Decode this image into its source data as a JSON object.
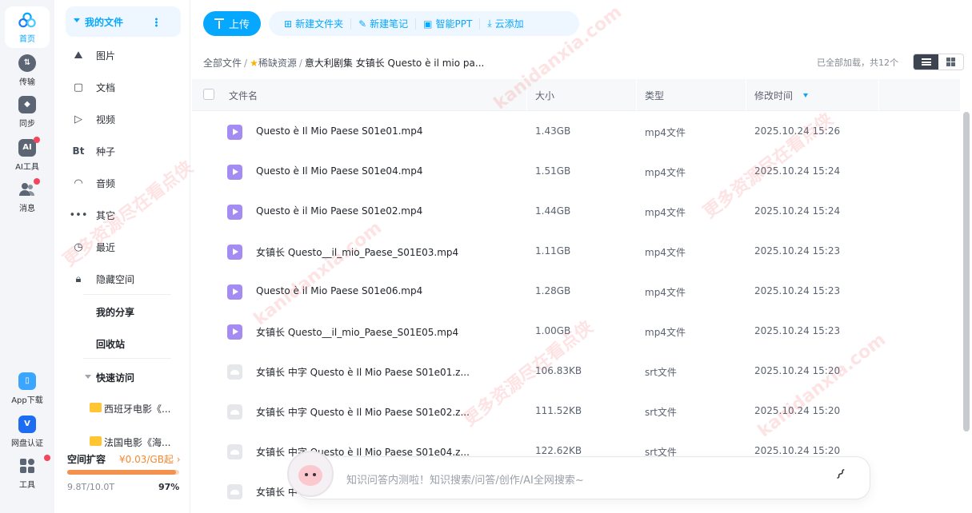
{
  "rail": {
    "home": "首页",
    "transfer": "传输",
    "sync": "同步",
    "ai_tools": "AI工具",
    "messages": "消息",
    "app_download": "App下载",
    "verify": "网盘认证",
    "tools": "工具"
  },
  "nav": {
    "my_files": "我的文件",
    "items": [
      "图片",
      "文档",
      "视频",
      "种子",
      "音频",
      "其它",
      "最近",
      "隐藏空间"
    ],
    "my_share": "我的分享",
    "recycle": "回收站",
    "quick_access": "快速访问",
    "quick_items": [
      "西班牙电影《...",
      "法国电影《海..."
    ],
    "space_label": "空间扩容",
    "space_price": "¥0.03/GB起 ›",
    "space_used": "9.8T/10.0T",
    "space_pct": "97%",
    "space_fraction": 0.97
  },
  "toolbar": {
    "upload": "上传",
    "new_folder": "新建文件夹",
    "new_note": "新建笔记",
    "smart_ppt": "智能PPT",
    "cloud_add": "云添加"
  },
  "breadcrumb": {
    "root": "全部文件",
    "level1": "稀缺资源",
    "current": "意大利剧集 女镇长 Questo è il mio pa..."
  },
  "status": {
    "loaded": "已全部加载，共12个"
  },
  "table": {
    "headers": {
      "name": "文件名",
      "size": "大小",
      "type": "类型",
      "modified": "修改时间"
    },
    "rows": [
      {
        "icon": "video",
        "name": "Questo è Il Mio Paese S01e01.mp4",
        "size": "1.43GB",
        "type": "mp4文件",
        "date": "2025.10.24 15:26"
      },
      {
        "icon": "video",
        "name": "Questo è Il Mio Paese S01e04.mp4",
        "size": "1.51GB",
        "type": "mp4文件",
        "date": "2025.10.24 15:24"
      },
      {
        "icon": "video",
        "name": "Questo è il Mio Paese S01e02.mp4",
        "size": "1.44GB",
        "type": "mp4文件",
        "date": "2025.10.24 15:24"
      },
      {
        "icon": "video",
        "name": "女镇长 Questo__il_mio_Paese_S01E03.mp4",
        "size": "1.11GB",
        "type": "mp4文件",
        "date": "2025.10.24 15:23"
      },
      {
        "icon": "video",
        "name": "Questo è il Mio Paese S01e06.mp4",
        "size": "1.28GB",
        "type": "mp4文件",
        "date": "2025.10.24 15:23"
      },
      {
        "icon": "video",
        "name": "女镇长 Questo__il_mio_Paese_S01E05.mp4",
        "size": "1.00GB",
        "type": "mp4文件",
        "date": "2025.10.24 15:23"
      },
      {
        "icon": "srt",
        "name": "女镇长 中字 Questo è Il Mio Paese S01e01.z...",
        "size": "106.83KB",
        "type": "srt文件",
        "date": "2025.10.24 15:20"
      },
      {
        "icon": "srt",
        "name": "女镇长 中字 Questo è Il Mio Paese S01e02.z...",
        "size": "111.52KB",
        "type": "srt文件",
        "date": "2025.10.24 15:20"
      },
      {
        "icon": "srt",
        "name": "女镇长 中字 Questo è Il Mio Paese S01e04.z...",
        "size": "122.62KB",
        "type": "srt文件",
        "date": "2025.10.24 15:20"
      },
      {
        "icon": "srt",
        "name": "女镇长 中",
        "size": "",
        "type": "",
        "date": ""
      }
    ]
  },
  "ai_search": {
    "placeholder": "知识问答内测啦！知识搜索/问答/创作/AI全网搜索~"
  },
  "watermark": {
    "line1": "kanidanxia.com",
    "line2": "更多资源尽在看点侠"
  }
}
